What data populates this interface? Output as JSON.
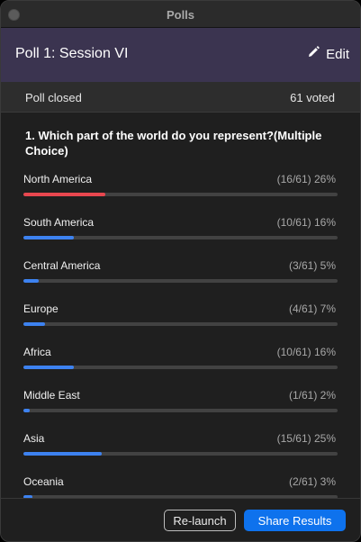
{
  "window": {
    "title": "Polls"
  },
  "header": {
    "poll_title": "Poll 1: Session VI",
    "edit_label": "Edit"
  },
  "status": {
    "state": "Poll closed",
    "votes": "61 voted"
  },
  "question": {
    "text": "1. Which part of the world do you represent?(Multiple Choice)",
    "options": [
      {
        "label": "North America",
        "count": "(16/61) 26%",
        "percent": 26,
        "color": "#e8474f"
      },
      {
        "label": "South America",
        "count": "(10/61) 16%",
        "percent": 16,
        "color": "#3d82f0"
      },
      {
        "label": "Central America",
        "count": "(3/61) 5%",
        "percent": 5,
        "color": "#3d82f0"
      },
      {
        "label": "Europe",
        "count": "(4/61) 7%",
        "percent": 7,
        "color": "#3d82f0"
      },
      {
        "label": "Africa",
        "count": "(10/61) 16%",
        "percent": 16,
        "color": "#3d82f0"
      },
      {
        "label": "Middle East",
        "count": "(1/61) 2%",
        "percent": 2,
        "color": "#3d82f0"
      },
      {
        "label": "Asia",
        "count": "(15/61) 25%",
        "percent": 25,
        "color": "#3d82f0"
      },
      {
        "label": "Oceania",
        "count": "(2/61) 3%",
        "percent": 3,
        "color": "#3d82f0"
      }
    ]
  },
  "footer": {
    "relaunch_label": "Re-launch",
    "share_label": "Share Results"
  },
  "icons": {
    "edit": "pencil-icon",
    "window_control": "close-dot-icon"
  }
}
